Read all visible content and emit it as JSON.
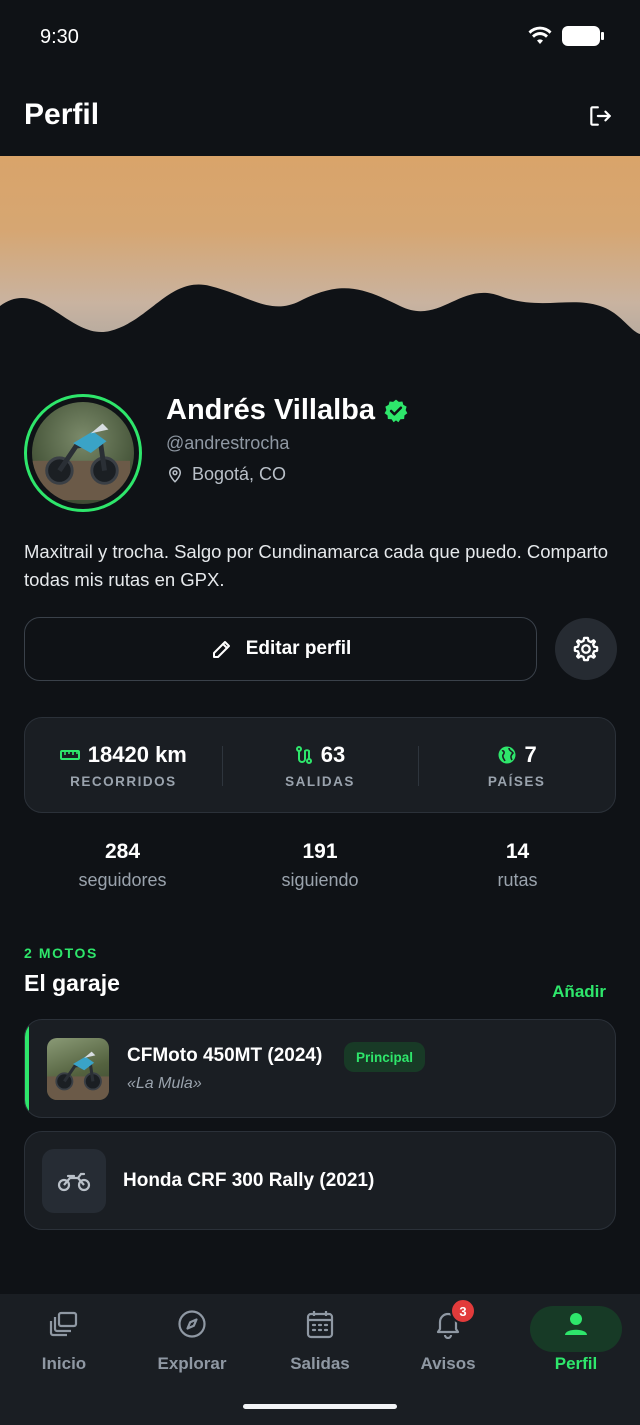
{
  "status_bar": {
    "time": "9:30"
  },
  "header": {
    "title": "Perfil",
    "logout_icon": "logout-icon"
  },
  "profile": {
    "name": "Andrés Villalba",
    "verified": true,
    "handle": "@andrestrocha",
    "location": "Bogotá, CO",
    "bio": "Maxitrail y trocha. Salgo por Cundinamarca cada que puedo. Comparto todas mis rutas en GPX."
  },
  "actions": {
    "edit_label": "Editar perfil",
    "settings_icon": "gear-icon"
  },
  "stats": [
    {
      "icon": "ruler-icon",
      "value": "18420 km",
      "label": "RECORRIDOS"
    },
    {
      "icon": "route-icon",
      "value": "63",
      "label": "SALIDAS"
    },
    {
      "icon": "globe-icon",
      "value": "7",
      "label": "PAÍSES"
    }
  ],
  "social": [
    {
      "value": "284",
      "label": "seguidores"
    },
    {
      "value": "191",
      "label": "siguiendo"
    },
    {
      "value": "14",
      "label": "rutas"
    }
  ],
  "garage": {
    "kicker": "2 MOTOS",
    "title": "El garaje",
    "add_label": "Añadir",
    "bikes": [
      {
        "name": "CFMoto 450MT (2024)",
        "nickname": "«La Mula»",
        "badge": "Principal"
      },
      {
        "name": "Honda CRF 300 Rally (2021)"
      }
    ]
  },
  "nav": {
    "items": [
      {
        "label": "Inicio",
        "icon": "stack-icon"
      },
      {
        "label": "Explorar",
        "icon": "compass-icon"
      },
      {
        "label": "Salidas",
        "icon": "calendar-icon"
      },
      {
        "label": "Avisos",
        "icon": "bell-icon",
        "badge": "3"
      },
      {
        "label": "Perfil",
        "icon": "person-icon"
      }
    ],
    "active": "Perfil"
  },
  "colors": {
    "accent": "#2ee66b",
    "background": "#0f1216",
    "card": "#1a1e23",
    "badge_red": "#e23b3b"
  }
}
